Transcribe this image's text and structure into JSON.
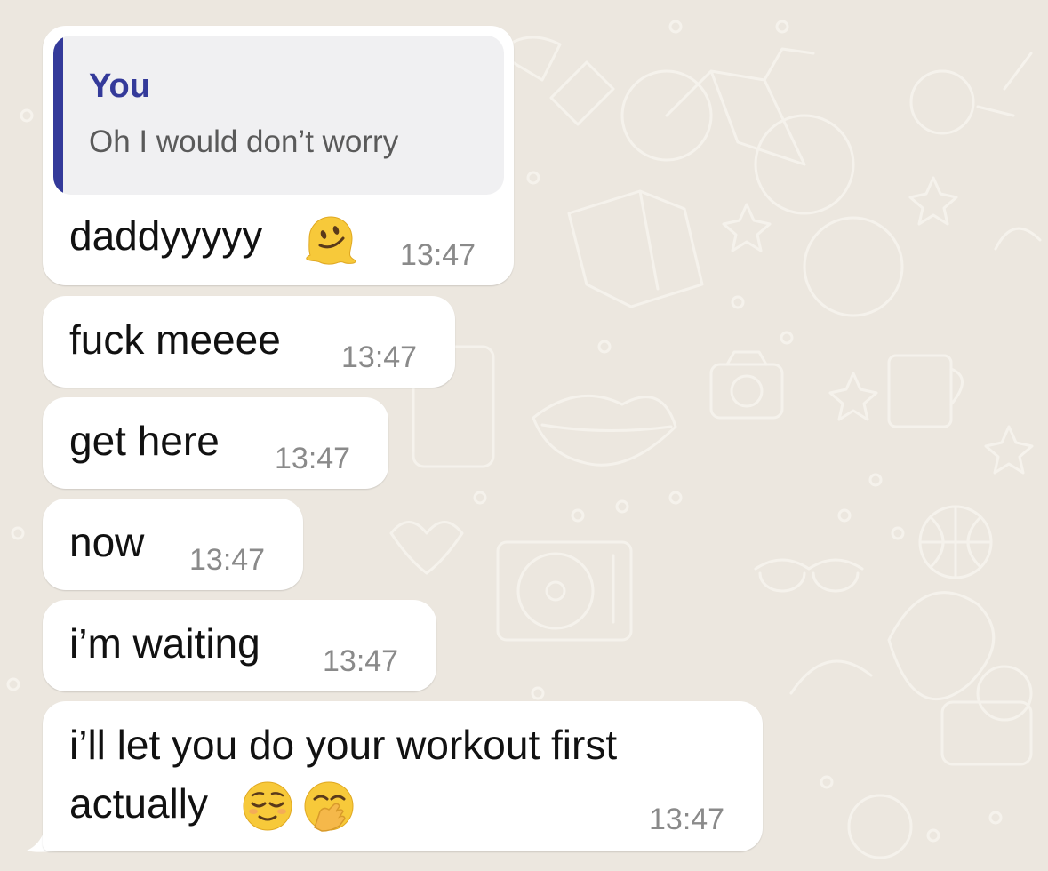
{
  "chat": {
    "wallpaper_color": "#ece7df",
    "bubble_color": "#ffffff",
    "messages": [
      {
        "quote_author": "You",
        "quote_text": "Oh I would don’t worry",
        "text": "daddyyyyy",
        "emoji": [
          "melting-face"
        ],
        "time": "13:47"
      },
      {
        "text": "fuck meeee",
        "time": "13:47"
      },
      {
        "text": "get here",
        "time": "13:47"
      },
      {
        "text": "now",
        "time": "13:47"
      },
      {
        "text": "i’m waiting",
        "time": "13:47"
      },
      {
        "text_line1": "i’ll let you do your workout first",
        "text_line2": "actually",
        "emoji": [
          "relieved-face",
          "face-with-hand-over-mouth"
        ],
        "time": "13:47"
      }
    ],
    "accent_color": "#343a9a"
  }
}
